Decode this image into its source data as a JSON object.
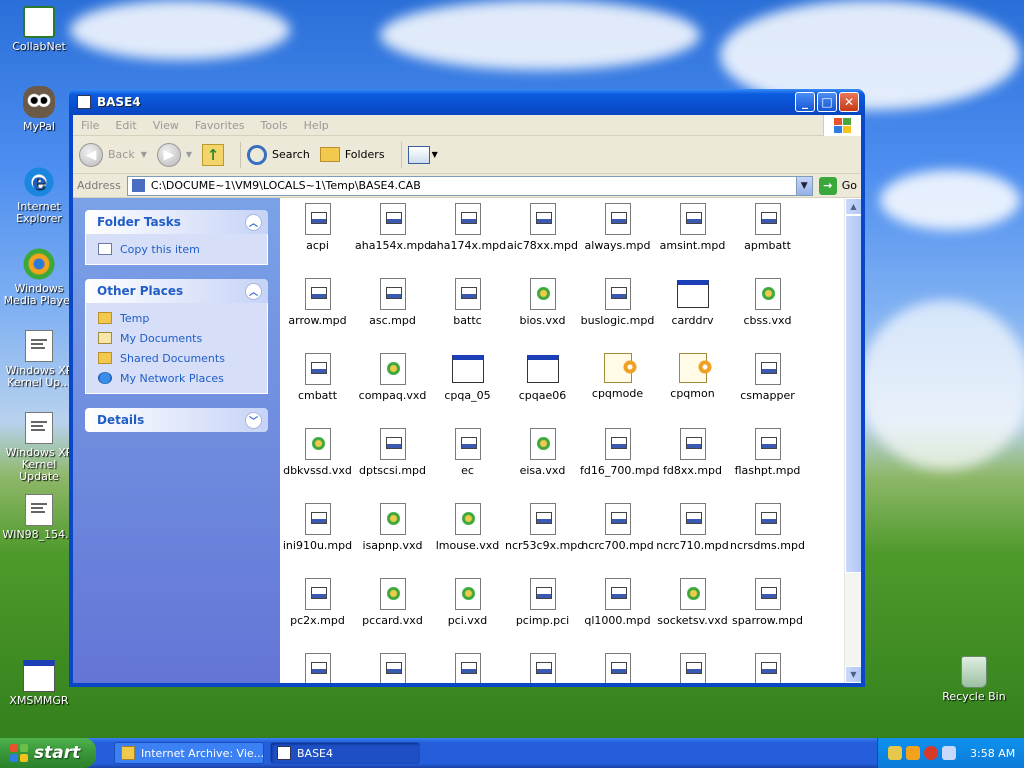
{
  "desktop": {
    "icons": [
      {
        "label": "CollabNet"
      },
      {
        "label": "MyPal"
      },
      {
        "label": "Internet Explorer"
      },
      {
        "label": "Windows Media Player"
      },
      {
        "label": "Windows XP Kernel Up..."
      },
      {
        "label": "Windows XP Kernel Update"
      },
      {
        "label": "WIN98_154..."
      },
      {
        "label": "XMSMMGR"
      },
      {
        "label": "Recycle Bin"
      }
    ]
  },
  "window": {
    "title": "BASE4",
    "buttons": {
      "minimize": "_",
      "maximize": "□",
      "close": "✕"
    },
    "menu": [
      "File",
      "Edit",
      "View",
      "Favorites",
      "Tools",
      "Help"
    ],
    "toolbar": {
      "back": "Back",
      "forward": "",
      "search": "Search",
      "folders": "Folders"
    },
    "address": {
      "label": "Address",
      "value": "C:\\DOCUME~1\\VM9\\LOCALS~1\\Temp\\BASE4.CAB",
      "go": "Go"
    },
    "taskpane": {
      "folder_tasks": {
        "title": "Folder Tasks",
        "items": [
          "Copy this item"
        ]
      },
      "other_places": {
        "title": "Other Places",
        "items": [
          "Temp",
          "My Documents",
          "Shared Documents",
          "My Network Places"
        ]
      },
      "details": {
        "title": "Details"
      }
    },
    "files": [
      {
        "name": "acpi",
        "type": "mpd"
      },
      {
        "name": "aha154x.mpd",
        "type": "mpd"
      },
      {
        "name": "aha174x.mpd",
        "type": "mpd"
      },
      {
        "name": "aic78xx.mpd",
        "type": "mpd"
      },
      {
        "name": "always.mpd",
        "type": "mpd"
      },
      {
        "name": "amsint.mpd",
        "type": "mpd"
      },
      {
        "name": "apmbatt",
        "type": "mpd"
      },
      {
        "name": "arrow.mpd",
        "type": "mpd"
      },
      {
        "name": "asc.mpd",
        "type": "mpd"
      },
      {
        "name": "battc",
        "type": "mpd"
      },
      {
        "name": "bios.vxd",
        "type": "vxd"
      },
      {
        "name": "buslogic.mpd",
        "type": "mpd"
      },
      {
        "name": "carddrv",
        "type": "win"
      },
      {
        "name": "cbss.vxd",
        "type": "vxd"
      },
      {
        "name": "cmbatt",
        "type": "mpd"
      },
      {
        "name": "compaq.vxd",
        "type": "vxd"
      },
      {
        "name": "cpqa_05",
        "type": "win"
      },
      {
        "name": "cpqae06",
        "type": "win"
      },
      {
        "name": "cpqmode",
        "type": "mode"
      },
      {
        "name": "cpqmon",
        "type": "mode"
      },
      {
        "name": "csmapper",
        "type": "mpd"
      },
      {
        "name": "dbkvssd.vxd",
        "type": "vxd"
      },
      {
        "name": "dptscsi.mpd",
        "type": "mpd"
      },
      {
        "name": "ec",
        "type": "mpd"
      },
      {
        "name": "eisa.vxd",
        "type": "vxd"
      },
      {
        "name": "fd16_700.mpd",
        "type": "mpd"
      },
      {
        "name": "fd8xx.mpd",
        "type": "mpd"
      },
      {
        "name": "flashpt.mpd",
        "type": "mpd"
      },
      {
        "name": "ini910u.mpd",
        "type": "mpd"
      },
      {
        "name": "isapnp.vxd",
        "type": "vxd"
      },
      {
        "name": "lmouse.vxd",
        "type": "vxd"
      },
      {
        "name": "ncr53c9x.mpd",
        "type": "mpd"
      },
      {
        "name": "ncrc700.mpd",
        "type": "mpd"
      },
      {
        "name": "ncrc710.mpd",
        "type": "mpd"
      },
      {
        "name": "ncrsdms.mpd",
        "type": "mpd"
      },
      {
        "name": "pc2x.mpd",
        "type": "mpd"
      },
      {
        "name": "pccard.vxd",
        "type": "vxd"
      },
      {
        "name": "pci.vxd",
        "type": "vxd"
      },
      {
        "name": "pcimp.pci",
        "type": "mpd"
      },
      {
        "name": "ql1000.mpd",
        "type": "mpd"
      },
      {
        "name": "socketsv.vxd",
        "type": "vxd"
      },
      {
        "name": "sparrow.mpd",
        "type": "mpd"
      },
      {
        "name": "",
        "type": "mpd"
      },
      {
        "name": "",
        "type": "mpd"
      },
      {
        "name": "",
        "type": "mpd"
      },
      {
        "name": "",
        "type": "mpd"
      },
      {
        "name": "",
        "type": "mpd"
      },
      {
        "name": "",
        "type": "mpd"
      },
      {
        "name": "",
        "type": "mpd"
      }
    ]
  },
  "taskbar": {
    "start": "start",
    "tasks": [
      {
        "label": "Internet Archive: Vie..."
      },
      {
        "label": "BASE4"
      }
    ],
    "clock": "3:58 AM"
  },
  "colors": {
    "title_bar": "#0a4fd0",
    "taskpane_link": "#215dc6",
    "start_green": "#3c9a3c"
  }
}
